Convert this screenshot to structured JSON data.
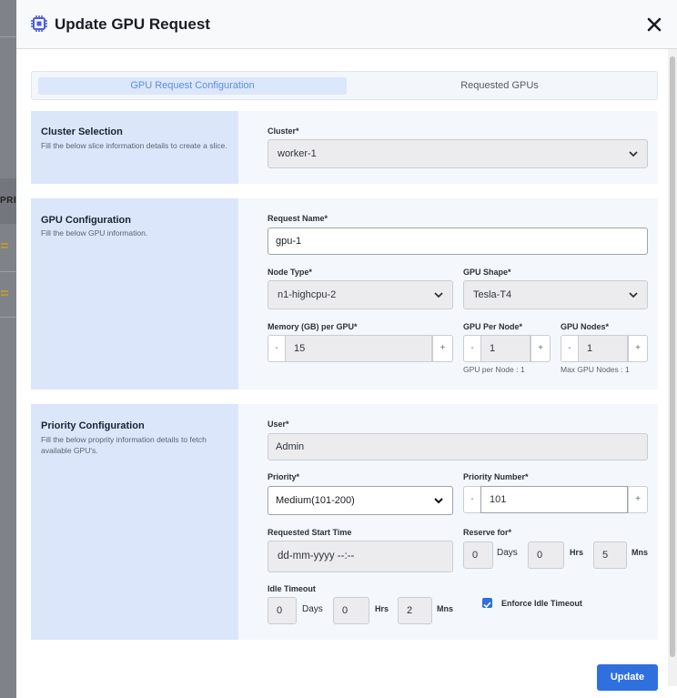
{
  "modal": {
    "title": "Update GPU Request",
    "close_label": "×",
    "update_label": "Update"
  },
  "background": {
    "header_fragment": "PRIOI"
  },
  "tabs": [
    {
      "label": "GPU Request Configuration",
      "active": true
    },
    {
      "label": "Requested GPUs",
      "active": false
    }
  ],
  "cluster_section": {
    "title": "Cluster Selection",
    "description": "Fill the below slice information details to create a slice.",
    "cluster_label": "Cluster*",
    "cluster_value": "worker-1"
  },
  "gpu_section": {
    "title": "GPU Configuration",
    "description": "Fill the below GPU information.",
    "request_name_label": "Request Name*",
    "request_name_value": "gpu-1",
    "node_type_label": "Node Type*",
    "node_type_value": "n1-highcpu-2",
    "gpu_shape_label": "GPU Shape*",
    "gpu_shape_value": "Tesla-T4",
    "memory_label": "Memory (GB) per GPU*",
    "memory_value": "15",
    "gpu_per_node_label": "GPU Per Node*",
    "gpu_per_node_value": "1",
    "gpu_per_node_hint": "GPU per Node : 1",
    "gpu_nodes_label": "GPU Nodes*",
    "gpu_nodes_value": "1",
    "gpu_nodes_hint": "Max GPU Nodes : 1",
    "minus": "-",
    "plus": "+"
  },
  "priority_section": {
    "title": "Priority Configuration",
    "description": "Fill the below proprity information details to fetch available GPU's.",
    "user_label": "User*",
    "user_value": "Admin",
    "priority_label": "Priority*",
    "priority_value": "Medium(101-200)",
    "priority_number_label": "Priority Number*",
    "priority_number_value": "101",
    "start_time_label": "Requested Start Time",
    "start_time_placeholder": "dd-mm-yyyy --:--",
    "reserve_label": "Reserve for*",
    "reserve_days": "0",
    "reserve_hrs": "0",
    "reserve_mns": "5",
    "idle_label": "Idle Timeout",
    "idle_days": "0",
    "idle_hrs": "0",
    "idle_mns": "2",
    "days_unit": "Days",
    "hrs_unit": "Hrs",
    "mns_unit": "Mns",
    "enforce_label": "Enforce Idle Timeout",
    "enforce_checked": true,
    "minus": "-",
    "plus": "+"
  },
  "colors": {
    "accent": "#2f6fde",
    "section_left": "#dbe6fb",
    "active_tab_text": "#5b8de6"
  }
}
